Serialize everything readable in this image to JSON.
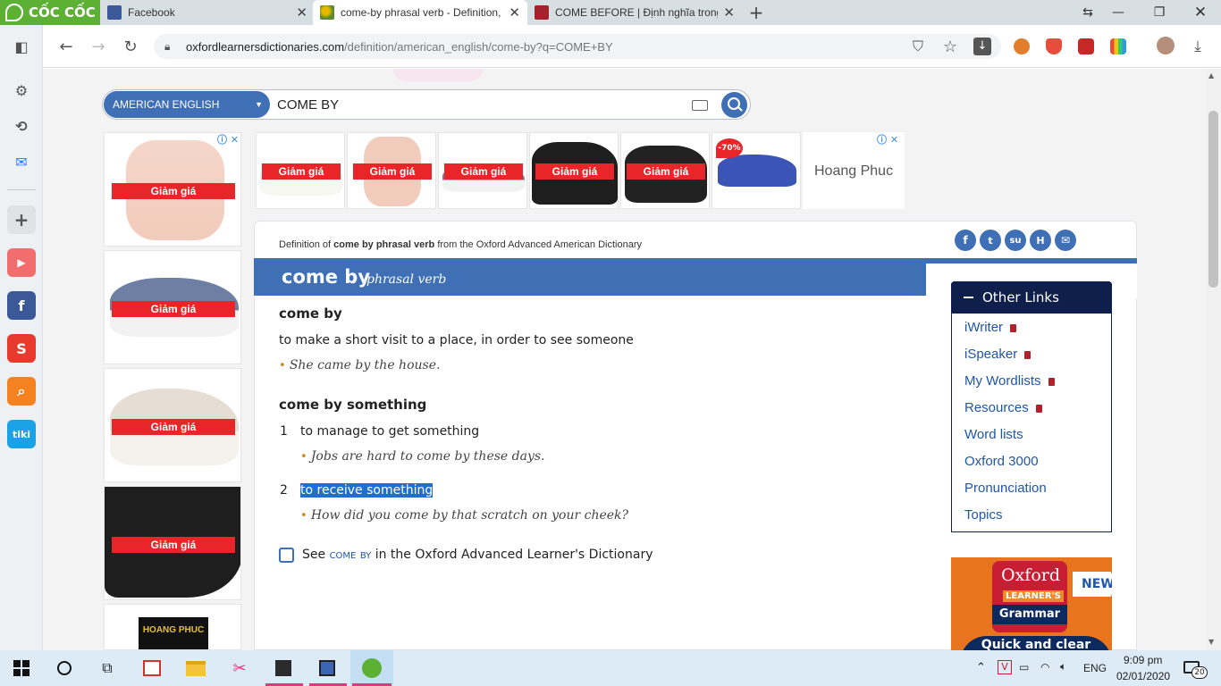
{
  "browser": {
    "logo_text": "CỐC CỐC",
    "tabs": [
      {
        "title": "Facebook",
        "active": false
      },
      {
        "title": "come-by phrasal verb - Definition,",
        "active": true
      },
      {
        "title": "COME BEFORE | Định nghĩa trong",
        "active": false
      }
    ],
    "url_domain": "oxfordlearnersdictionaries.com",
    "url_path": "/definition/american_english/come-by?q=COME+BY"
  },
  "search": {
    "dictionary": "AMERICAN ENGLISH",
    "query": "COME BY"
  },
  "ads": {
    "label": "Giảm giá",
    "discount": "-70%",
    "brand_banner": "Hoang Phuc",
    "brand_logo": "HOANG PHUC"
  },
  "entry": {
    "definition_of_prefix": "Definition of ",
    "definition_of_term": "come by phrasal verb",
    "definition_of_suffix": " from the Oxford Advanced American Dictionary",
    "headword": "come by",
    "pos": "phrasal verb",
    "sense_groups": [
      {
        "phrase": "come by",
        "definition": "to make a short visit to a place, in order to see someone",
        "example": "She came by the house."
      },
      {
        "phrase": "come by something",
        "senses": [
          {
            "num": "1",
            "definition": "to manage to get something",
            "example": "Jobs are hard to come by these days."
          },
          {
            "num": "2",
            "definition": "to receive something",
            "example": "How did you come by that scratch on your cheek?"
          }
        ]
      }
    ],
    "see_also": {
      "prefix": "See ",
      "term": "come by",
      "suffix": " in the Oxford Advanced Learner's Dictionary"
    }
  },
  "other_links": {
    "title": "Other Links",
    "items": [
      "iWriter",
      "iSpeaker",
      "My Wordlists",
      "Resources",
      "Word lists",
      "Oxford 3000",
      "Pronunciation",
      "Topics"
    ],
    "locked": [
      true,
      true,
      true,
      true,
      false,
      false,
      false,
      false
    ]
  },
  "grammar_ad": {
    "brand": "Oxford",
    "line2": "LEARNER'S",
    "line3": "Grammar",
    "badge": "NEW",
    "tagline": "Quick and clear"
  },
  "taskbar": {
    "language": "ENG",
    "time": "9:09 pm",
    "date": "02/01/2020",
    "notifications": "20"
  },
  "colors": {
    "oxford_blue": "#3f6fb5",
    "navy": "#0d1f4a",
    "sale_red": "#e8262a",
    "coccoc_green": "#5cb135"
  }
}
